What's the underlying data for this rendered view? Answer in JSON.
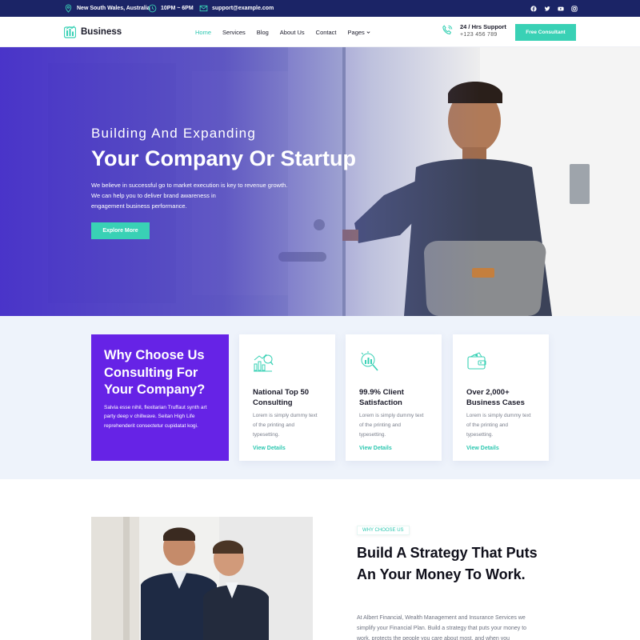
{
  "topbar": {
    "location": "New South Wales, Australia",
    "hours": "10PM ~ 6PM",
    "email": "support@example.com",
    "socials": [
      "facebook-icon",
      "twitter-icon",
      "youtube-icon",
      "instagram-icon"
    ]
  },
  "nav": {
    "brand": "Business",
    "menu": [
      "Home",
      "Services",
      "Blog",
      "About Us",
      "Contact",
      "Pages"
    ],
    "active": "Home",
    "support_title": "24 / Hrs Support",
    "support_phone": "+123 456 789",
    "cta": "Free Consultant"
  },
  "hero": {
    "subtitle": "Building And Expanding",
    "title": "Your Company Or Startup",
    "text_lines": [
      "We believe in successful go to market execution is key to revenue growth.",
      "We can help you to deliver brand awareness in",
      "engagement business performance."
    ],
    "button": "Explore More"
  },
  "features": {
    "why_title": "Why Choose Us Consulting For Your Company?",
    "why_text": "Salvia esse nihil, flexitarian Truffaut synth art party deep v chillwave. Seitan High Life reprehenderit consectetur cupidatat kogi.",
    "cards": [
      {
        "icon": "chart-growth-icon",
        "title": "National Top 50 Consulting",
        "text": "Lorem is simply dummy text of the printing and typesetting.",
        "link": "View Details"
      },
      {
        "icon": "magnifier-analysis-icon",
        "title": "99.9% Client Satisfaction",
        "text": "Lorem is simply dummy text of the printing and typesetting.",
        "link": "View Details"
      },
      {
        "icon": "wallet-icon",
        "title": "Over 2,000+ Business Cases",
        "text": "Lorem is simply dummy text of the printing and typesetting.",
        "link": "View Details"
      }
    ]
  },
  "about": {
    "badge": "WHY CHOOSE US",
    "title": "Build A Strategy That Puts An Your Money To Work.",
    "text": "At Albert Financial, Wealth Management and Insurance Services we simplify your Financial Plan. Build a strategy that puts your money to work, protects the people you care about most, and when you"
  },
  "colors": {
    "topbar": "#1b2466",
    "accent": "#39d1b5",
    "purple": "#6623e6",
    "section_bg": "#eef3fb"
  }
}
